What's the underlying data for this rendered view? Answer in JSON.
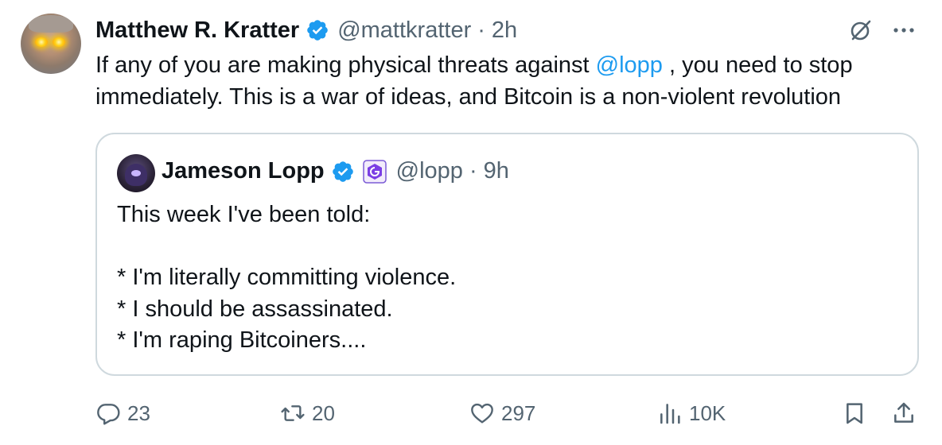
{
  "colors": {
    "accent": "#1d9bf0",
    "text": "#0f1419",
    "muted": "#536471",
    "border": "#cfd9de",
    "verified": "#1d9bf0"
  },
  "tweet": {
    "author_name": "Matthew R. Kratter",
    "author_handle": "@mattkratter",
    "separator": "·",
    "time": "2h",
    "text_before_mention": "If any of you are making physical threats against ",
    "mention": "@lopp",
    "text_after_mention": " , you need to stop immediately. This is a war of ideas, and Bitcoin is a non-violent revolution",
    "icons": [
      "avatar",
      "verified-badge-icon",
      "grok-icon",
      "more-icon"
    ]
  },
  "quote": {
    "author_name": "Jameson Lopp",
    "author_handle": "@lopp",
    "separator": "·",
    "time": "9h",
    "text": "This week I've been told:\n\n* I'm literally committing violence.\n* I should be assassinated.\n* I'm raping Bitcoiners....",
    "icons": [
      "verified-badge-icon",
      "affiliate-badge-icon"
    ]
  },
  "actions": {
    "replies": "23",
    "retweets": "20",
    "likes": "297",
    "views": "10K",
    "icons": [
      "reply-icon",
      "retweet-icon",
      "like-icon",
      "views-icon",
      "bookmark-icon",
      "share-icon"
    ]
  }
}
